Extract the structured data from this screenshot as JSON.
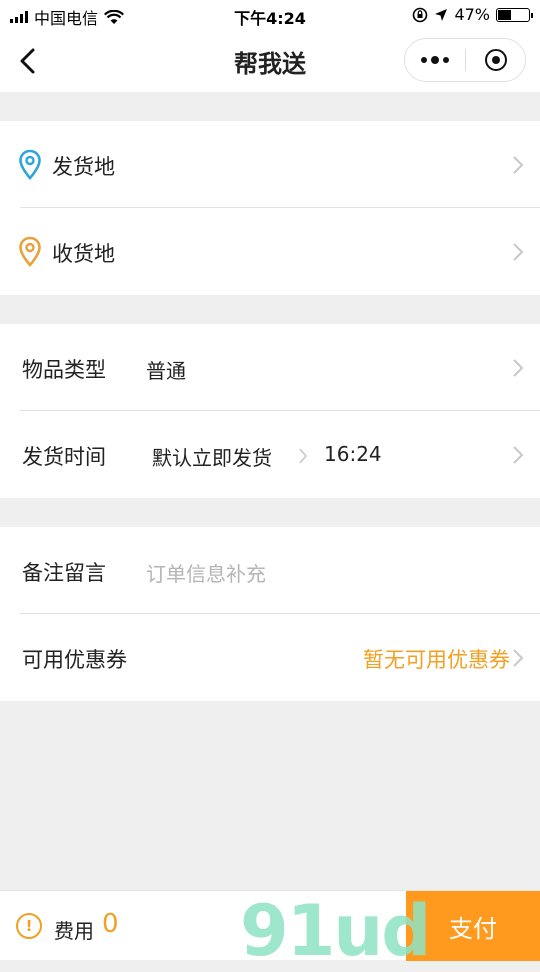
{
  "status_bar": {
    "carrier": "中国电信",
    "time": "下午4:24",
    "battery_percent": "47%",
    "battery_level": 0.47
  },
  "nav": {
    "title": "帮我送"
  },
  "address": {
    "pickup_label": "发货地",
    "delivery_label": "收货地",
    "pickup_icon_color": "#2fa6d8",
    "delivery_icon_color": "#e9a23b"
  },
  "goods": {
    "type_label": "物品类型",
    "type_value": "普通",
    "time_label": "发货时间",
    "time_value": "默认立即发货",
    "time_clock": "16:24"
  },
  "extra": {
    "note_label": "备注留言",
    "note_placeholder": "订单信息补充",
    "coupon_label": "可用优惠券",
    "coupon_value": "暂无可用优惠券"
  },
  "bottom": {
    "info_icon": "!",
    "fee_label": "费用",
    "fee_value": "0",
    "pay_label": "支付"
  },
  "watermark": "91ud",
  "colors": {
    "accent": "#ff9a1e",
    "accent_text": "#f2a023",
    "background": "#efefef"
  }
}
